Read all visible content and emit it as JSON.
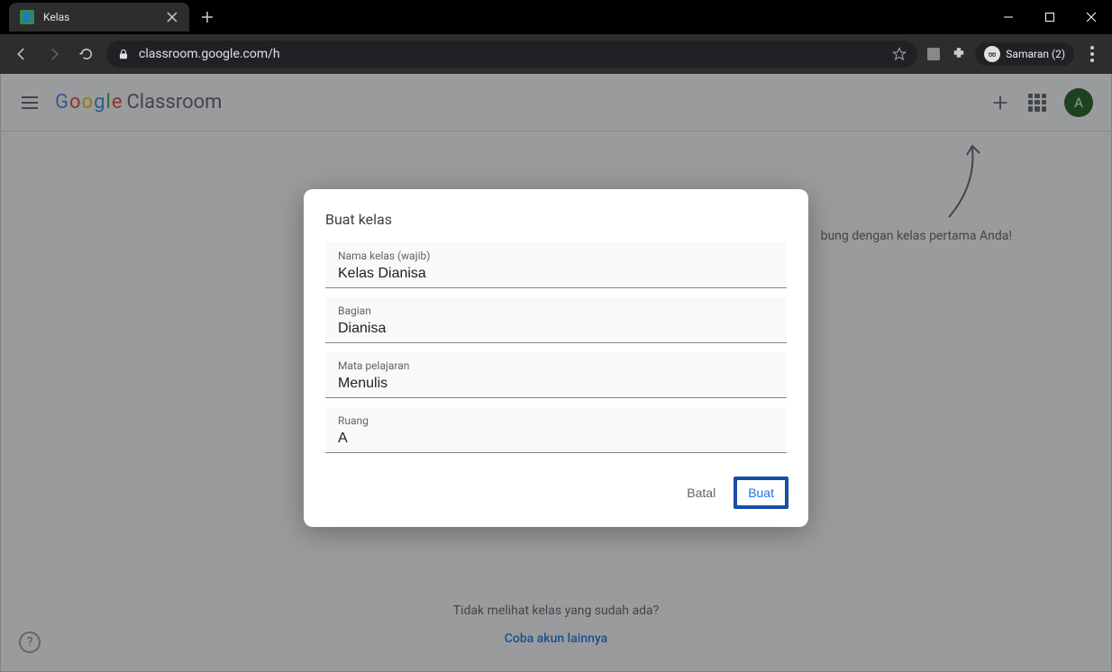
{
  "browser": {
    "tab_title": "Kelas",
    "url": "classroom.google.com/h",
    "incognito_label": "Samaran (2)"
  },
  "appbar": {
    "logo_google": "Google",
    "logo_product": "Classroom",
    "avatar_initial": "A"
  },
  "hint": {
    "arrow_target_text": "bung dengan kelas pertama Anda!"
  },
  "page": {
    "no_class_text": "Tidak melihat kelas yang sudah ada?",
    "try_other_text": "Coba akun lainnya"
  },
  "dialog": {
    "title": "Buat kelas",
    "fields": {
      "name": {
        "label": "Nama kelas (wajib)",
        "value": "Kelas Dianisa"
      },
      "section": {
        "label": "Bagian",
        "value": "Dianisa"
      },
      "subject": {
        "label": "Mata pelajaran",
        "value": "Menulis"
      },
      "room": {
        "label": "Ruang",
        "value": "A"
      }
    },
    "actions": {
      "cancel": "Batal",
      "create": "Buat"
    }
  }
}
